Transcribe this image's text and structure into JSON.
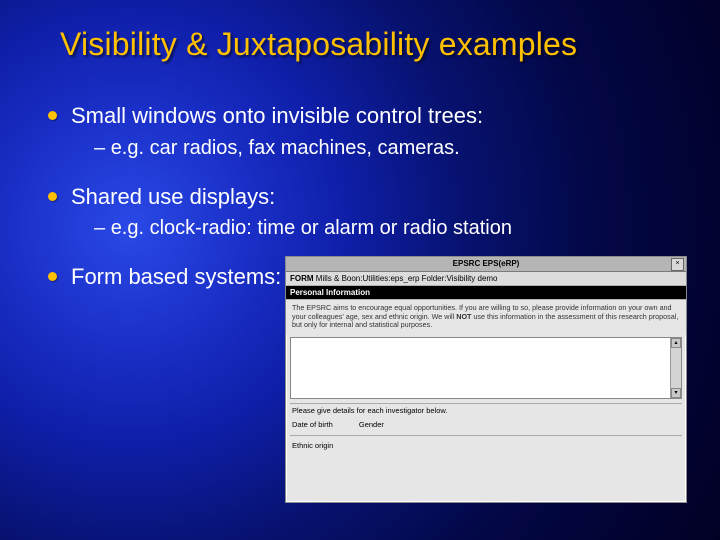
{
  "title": "Visibility & Juxtaposability examples",
  "bullets": {
    "b1": {
      "text": "Small windows onto invisible control trees:",
      "sub": "e.g. car radios, fax machines, cameras."
    },
    "b2": {
      "text": "Shared use displays:",
      "sub": "e.g. clock-radio: time or alarm or radio station"
    },
    "b3": {
      "text": "Form based systems:"
    }
  },
  "form": {
    "window_title": "EPSRC EPS(eRP)",
    "close_glyph": "×",
    "path_label": "FORM",
    "path_value": "Mills & Boon:Utilities:eps_erp Folder:Visibility demo",
    "section": "Personal Information",
    "intro_1": "The EPSRC aims to encourage equal opportunities. If you are willing to so, please provide information on your own and your colleagues' age, sex and ethnic origin. We will ",
    "intro_not": "NOT",
    "intro_2": " use this information in the assessment of this research proposal, but only for internal and statistical purposes.",
    "instruct": "Please give details for each investigator below.",
    "field_dob": "Date of birth",
    "field_gender": "Gender",
    "field_ethnic": "Ethnic origin",
    "scroll_up": "▴",
    "scroll_down": "▾"
  }
}
